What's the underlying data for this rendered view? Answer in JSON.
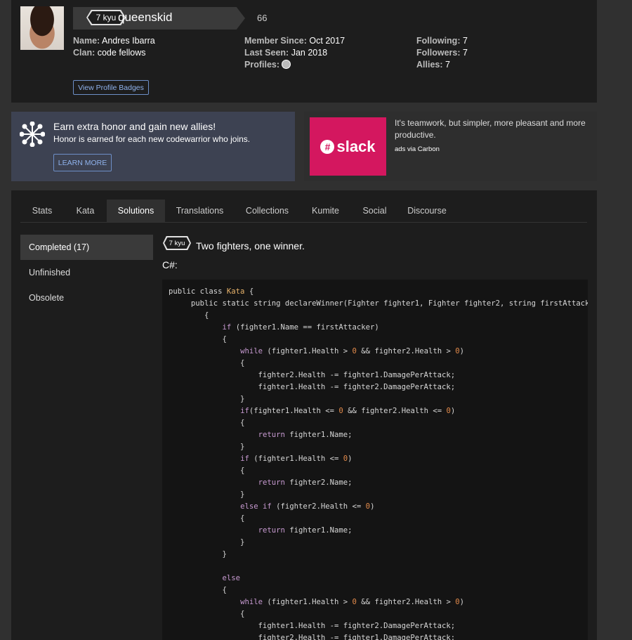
{
  "profile": {
    "rank": "7 kyu",
    "username": "queenskid",
    "honor": "66",
    "name_label": "Name:",
    "name_value": "Andres Ibarra",
    "clan_label": "Clan:",
    "clan_value": "code fellows",
    "member_since_label": "Member Since:",
    "member_since_value": "Oct 2017",
    "last_seen_label": "Last Seen:",
    "last_seen_value": "Jan 2018",
    "profiles_label": "Profiles:",
    "following_label": "Following:",
    "following_value": "7",
    "followers_label": "Followers:",
    "followers_value": "7",
    "allies_label": "Allies:",
    "allies_value": "7",
    "badges_button": "View Profile Badges"
  },
  "promo": {
    "title": "Earn extra honor and gain new allies!",
    "subtitle": "Honor is earned for each new codewarrior who joins.",
    "button": "LEARN MORE"
  },
  "ad": {
    "logo_text": "slack",
    "text": "It's teamwork, but simpler, more pleasant and more productive.",
    "via": "ads via Carbon"
  },
  "tabs": [
    "Stats",
    "Kata",
    "Solutions",
    "Translations",
    "Collections",
    "Kumite",
    "Social",
    "Discourse"
  ],
  "active_tab": "Solutions",
  "sidebar": {
    "items": [
      "Completed (17)",
      "Unfinished",
      "Obsolete"
    ],
    "active": "Completed (17)"
  },
  "solution": {
    "rank": "7 kyu",
    "title": "Two fighters, one winner.",
    "language": "C#:",
    "code_lines": [
      "public class Kata {",
      "     public static string declareWinner(Fighter fighter1, Fighter fighter2, string firstAttacker)",
      "        {",
      "            if (fighter1.Name == firstAttacker)",
      "            {",
      "                while (fighter1.Health > 0 && fighter2.Health > 0)",
      "                {",
      "                    fighter2.Health -= fighter1.DamagePerAttack;",
      "                    fighter1.Health -= fighter2.DamagePerAttack;",
      "                }",
      "                if(fighter1.Health <= 0 && fighter2.Health <= 0)",
      "                {",
      "                    return fighter1.Name;",
      "                }",
      "                if (fighter1.Health <= 0)",
      "                {",
      "                    return fighter2.Name;",
      "                }",
      "                else if (fighter2.Health <= 0)",
      "                {",
      "                    return fighter1.Name;",
      "                }",
      "            }",
      "",
      "            else",
      "            {",
      "                while (fighter1.Health > 0 && fighter2.Health > 0)",
      "                {",
      "                    fighter1.Health -= fighter2.DamagePerAttack;",
      "                    fighter2.Health -= fighter1.DamagePerAttack;"
    ]
  },
  "colors": {
    "page_bg": "#303030",
    "panel_bg": "#1d1d1d",
    "promo_bg": "#3d4252",
    "link": "#8fb2ec",
    "slack": "#d4175f",
    "keyword": "#c79ad1",
    "number": "#e28a4b",
    "class_name": "#e8b36b"
  }
}
